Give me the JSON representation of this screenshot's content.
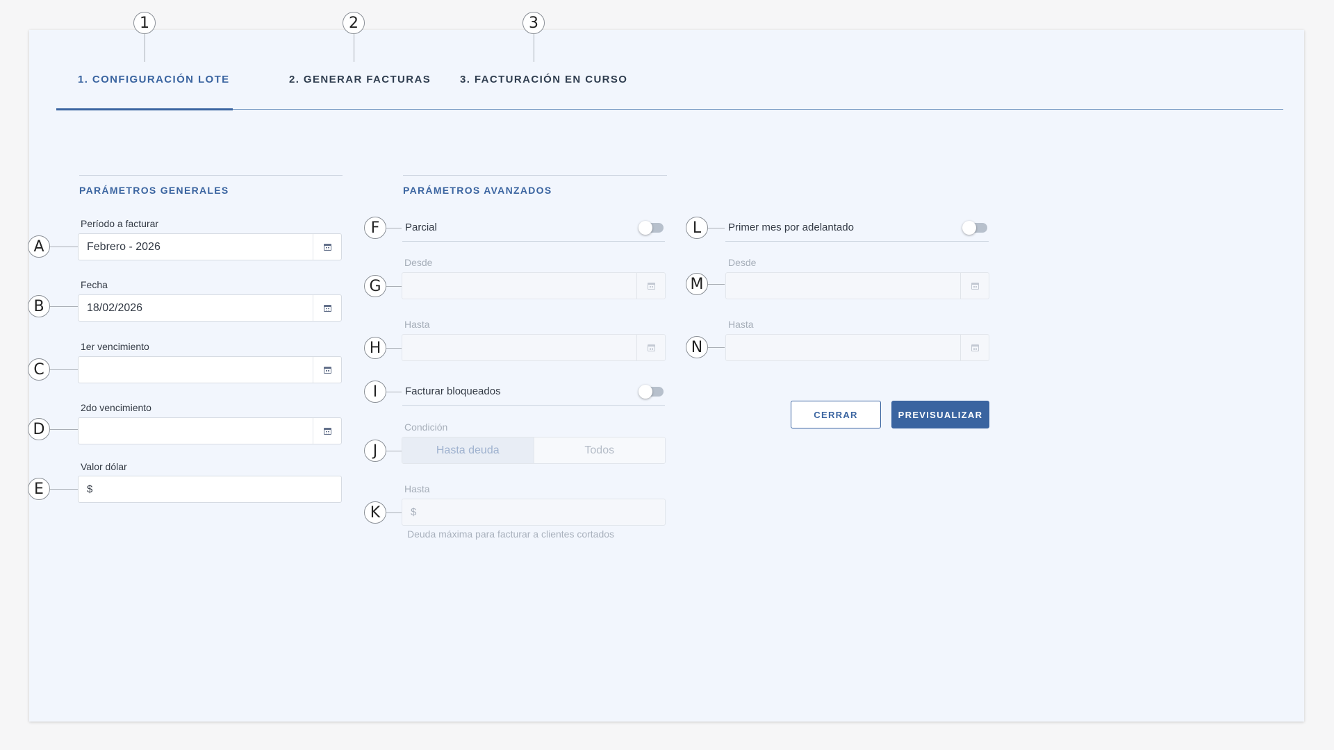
{
  "steps": {
    "callouts": [
      "1",
      "2",
      "3"
    ],
    "tabs": [
      {
        "label": "1. CONFIGURACIÓN LOTE",
        "active": true
      },
      {
        "label": "2. GENERAR FACTURAS",
        "active": false
      },
      {
        "label": "3. FACTURACIÓN EN CURSO",
        "active": false
      }
    ]
  },
  "general": {
    "title": "PARÁMETROS GENERALES",
    "periodo": {
      "callout": "A",
      "label": "Período a facturar",
      "value": "Febrero - 2026",
      "icon": "calendar-icon"
    },
    "fecha": {
      "callout": "B",
      "label": "Fecha",
      "value": "18/02/2026",
      "icon": "calendar-icon"
    },
    "venc1": {
      "callout": "C",
      "label": "1er vencimiento",
      "value": "",
      "icon": "calendar-icon"
    },
    "venc2": {
      "callout": "D",
      "label": "2do vencimiento",
      "value": "",
      "icon": "calendar-icon"
    },
    "dolar": {
      "callout": "E",
      "label": "Valor dólar",
      "prefix": "$",
      "value": ""
    }
  },
  "advanced": {
    "title": "PARÁMETROS AVANZADOS",
    "parcial": {
      "callout": "F",
      "label": "Parcial",
      "on": false
    },
    "parcial_desde": {
      "callout": "G",
      "label": "Desde",
      "value": "",
      "icon": "calendar-icon"
    },
    "parcial_hasta": {
      "callout": "H",
      "label": "Hasta",
      "value": "",
      "icon": "calendar-icon"
    },
    "bloqueados": {
      "callout": "I",
      "label": "Facturar bloqueados",
      "on": false
    },
    "condicion": {
      "callout": "J",
      "label": "Condición",
      "options": [
        "Hasta deuda",
        "Todos"
      ],
      "selected": "Hasta deuda"
    },
    "deuda_hasta": {
      "callout": "K",
      "label": "Hasta",
      "prefix": "$",
      "value": "",
      "hint": "Deuda máxima para facturar a clientes cortados"
    },
    "primer_mes": {
      "callout": "L",
      "label": "Primer mes por adelantado",
      "on": false
    },
    "primer_desde": {
      "callout": "M",
      "label": "Desde",
      "value": "",
      "icon": "calendar-icon"
    },
    "primer_hasta": {
      "callout": "N",
      "label": "Hasta",
      "value": "",
      "icon": "calendar-icon"
    }
  },
  "actions": {
    "close_label": "CERRAR",
    "preview_label": "PREVISUALIZAR"
  },
  "colors": {
    "accent": "#3a64a0",
    "panel_background": "#f2f6fd",
    "page_background": "#f6f6f7"
  }
}
